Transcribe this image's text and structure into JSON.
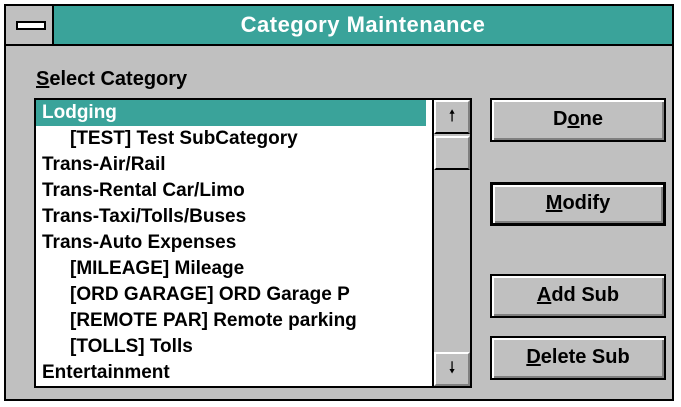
{
  "window": {
    "title": "Category Maintenance"
  },
  "select_label": {
    "accel": "S",
    "rest": "elect Category"
  },
  "categories": [
    {
      "label": "Lodging",
      "selected": true,
      "sub": false
    },
    {
      "label": "[TEST] Test SubCategory",
      "selected": false,
      "sub": true
    },
    {
      "label": "Trans-Air/Rail",
      "selected": false,
      "sub": false
    },
    {
      "label": "Trans-Rental Car/Limo",
      "selected": false,
      "sub": false
    },
    {
      "label": "Trans-Taxi/Tolls/Buses",
      "selected": false,
      "sub": false
    },
    {
      "label": "Trans-Auto Expenses",
      "selected": false,
      "sub": false
    },
    {
      "label": "[MILEAGE] Mileage",
      "selected": false,
      "sub": true
    },
    {
      "label": "[ORD GARAGE] ORD Garage P",
      "selected": false,
      "sub": true
    },
    {
      "label": "[REMOTE PAR] Remote parking",
      "selected": false,
      "sub": true
    },
    {
      "label": "[TOLLS] Tolls",
      "selected": false,
      "sub": true
    },
    {
      "label": "Entertainment",
      "selected": false,
      "sub": false
    }
  ],
  "scrollbar": {
    "up_glyph": "🠕",
    "down_glyph": "🠗",
    "up_icon": "arrow-up-icon",
    "down_icon": "arrow-down-icon"
  },
  "buttons": {
    "done": {
      "before": "D",
      "accel": "o",
      "after": "ne"
    },
    "modify": {
      "before": "",
      "accel": "M",
      "after": "odify"
    },
    "add_sub": {
      "before": "",
      "accel": "A",
      "after": "dd Sub"
    },
    "delete_sub": {
      "before": "",
      "accel": "D",
      "after": "elete Sub"
    }
  },
  "colors": {
    "titlebar": "#3aa39a",
    "selection": "#3aa39a",
    "face": "#c0c0c0"
  }
}
